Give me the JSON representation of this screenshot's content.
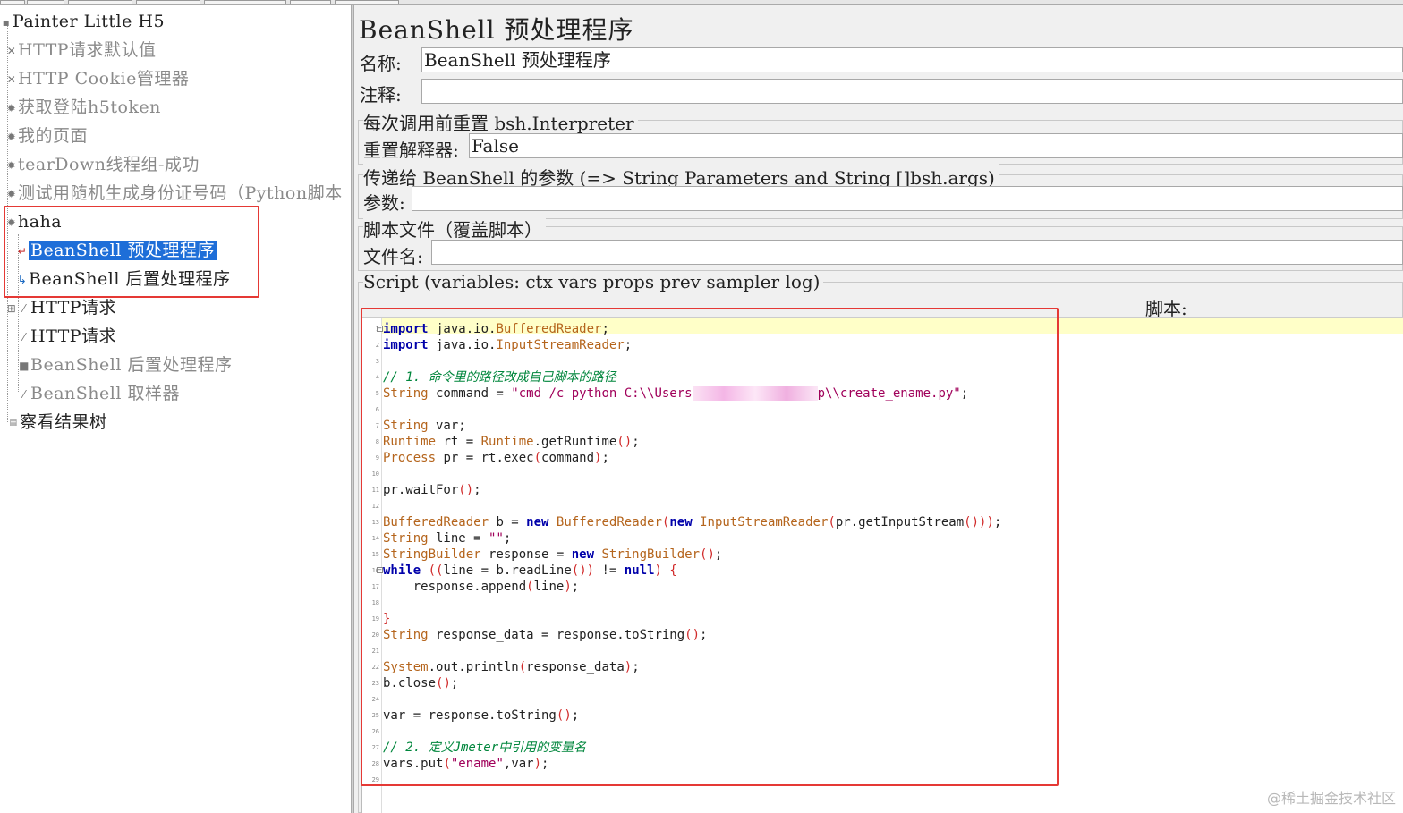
{
  "tree": {
    "items": [
      {
        "label": "Painter Little H5",
        "icon": "testplan-icon"
      },
      {
        "label": "HTTP请求默认值",
        "icon": "config-icon"
      },
      {
        "label": "HTTP Cookie管理器",
        "icon": "config-icon"
      },
      {
        "label": "获取登陆h5token",
        "icon": "gear-icon"
      },
      {
        "label": "我的页面",
        "icon": "gear-icon"
      },
      {
        "label": "tearDown线程组-成功",
        "icon": "gear-icon"
      },
      {
        "label": "测试用随机生成身份证号码（Python脚本",
        "icon": "gear-icon"
      },
      {
        "label": "haha",
        "icon": "gear-icon"
      },
      {
        "label": "BeanShell 预处理程序",
        "icon": "preprocessor-icon"
      },
      {
        "label": "BeanShell 后置处理程序",
        "icon": "postprocessor-icon"
      },
      {
        "label": "HTTP请求",
        "icon": "sampler-icon"
      },
      {
        "label": "HTTP请求",
        "icon": "sampler-icon"
      },
      {
        "label": "BeanShell 后置处理程序",
        "icon": "postprocessor-icon"
      },
      {
        "label": "BeanShell 取样器",
        "icon": "sampler-icon"
      },
      {
        "label": "察看结果树",
        "icon": "listener-icon"
      }
    ]
  },
  "panel": {
    "title": "BeanShell 预处理程序",
    "name_label": "名称:",
    "name_value": "BeanShell 预处理程序",
    "comment_label": "注释:",
    "comment_value": "",
    "reset_group_title": "每次调用前重置 bsh.Interpreter",
    "reset_label": "重置解释器:",
    "reset_value": "False",
    "params_group_title": "传递给 BeanShell 的参数 (=> String Parameters and String []bsh.args)",
    "params_label": "参数:",
    "params_value": "",
    "file_group_title": "脚本文件（覆盖脚本）",
    "file_label": "文件名:",
    "file_value": "",
    "script_group_title": "Script (variables: ctx vars props prev sampler log)",
    "script_label": "脚本:"
  },
  "code": {
    "lines": [
      "import java.io.BufferedReader;",
      "import java.io.InputStreamReader;",
      "",
      "// 1. 命令里的路径改成自己脚本的路径",
      "String command = \"cmd /c python C:\\\\Users[redacted]p\\\\create_ename.py\";",
      "",
      "String var;",
      "Runtime rt = Runtime.getRuntime();",
      "Process pr = rt.exec(command);",
      "",
      "pr.waitFor();",
      "",
      "BufferedReader b = new BufferedReader(new InputStreamReader(pr.getInputStream()));",
      "String line = \"\";",
      "StringBuilder response = new StringBuilder();",
      "while ((line = b.readLine()) != null) {",
      "    response.append(line);",
      "",
      "}",
      "String response_data = response.toString();",
      "",
      "System.out.println(response_data);",
      "b.close();",
      "",
      "var = response.toString();",
      "",
      "// 2. 定义Jmeter中引用的变量名",
      "vars.put(\"ename\",var);",
      ""
    ]
  },
  "watermark": "@稀土掘金技术社区"
}
